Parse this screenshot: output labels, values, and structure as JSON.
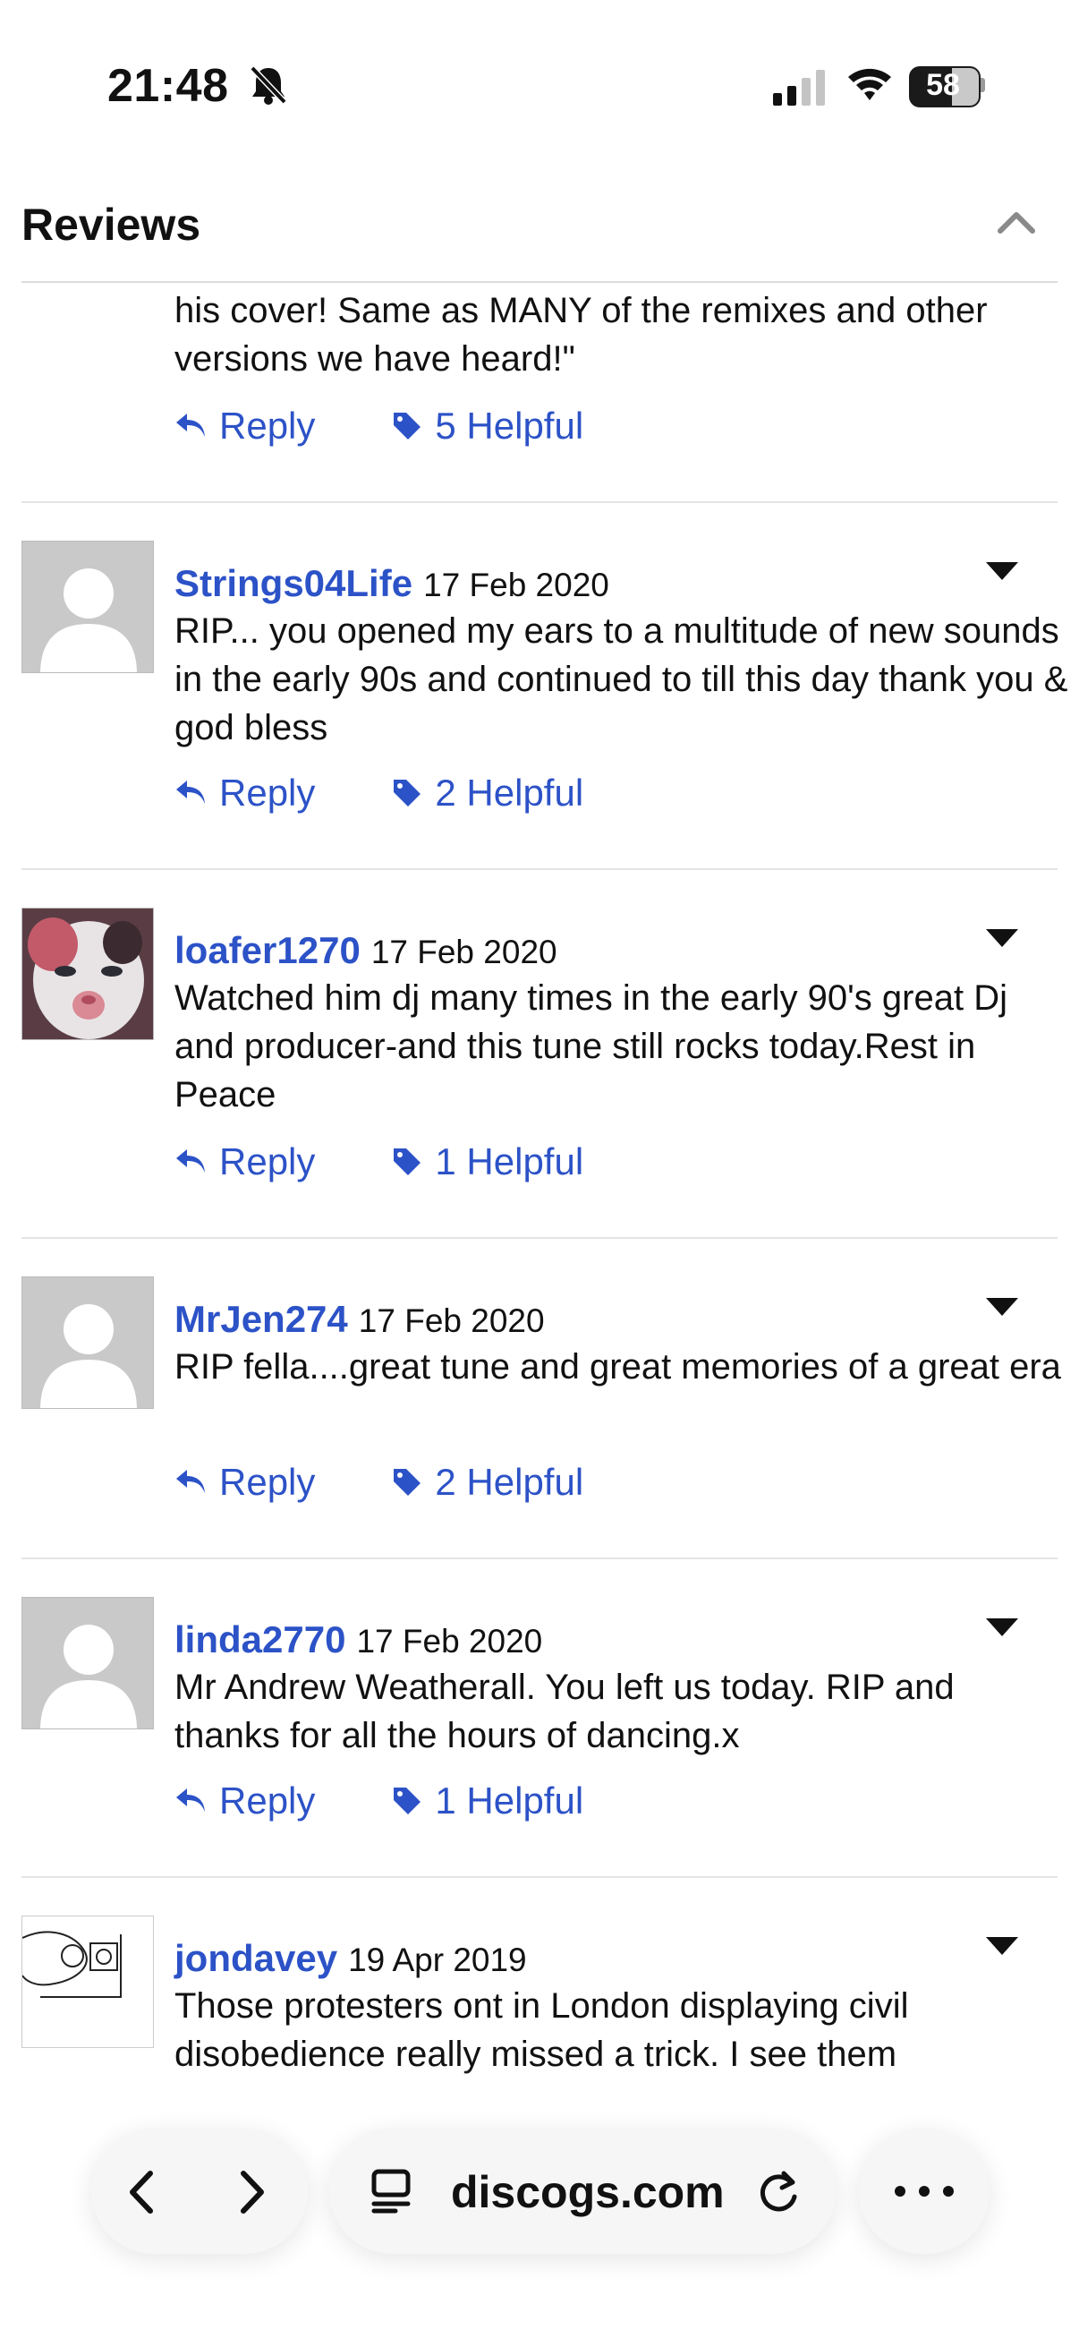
{
  "status_bar": {
    "time": "21:48",
    "battery": "58"
  },
  "header": {
    "title": "Reviews"
  },
  "top_fragment": {
    "text": "his cover! Same as MANY of the remixes and other versions we have heard!\"",
    "reply_label": "Reply",
    "helpful_label": "5 Helpful"
  },
  "reviews": [
    {
      "user": "Strings04Life",
      "date": "17 Feb 2020",
      "text": "RIP... you opened my ears to a multitude of new sounds in the early 90s and continued to till this day thank you & god bless",
      "reply_label": "Reply",
      "helpful_label": "2 Helpful"
    },
    {
      "user": "loafer1270",
      "date": "17 Feb 2020",
      "text": "Watched him dj many times in the early 90's great Dj and producer-and this tune still rocks today.Rest in Peace",
      "reply_label": "Reply",
      "helpful_label": "1 Helpful"
    },
    {
      "user": "MrJen274",
      "date": "17 Feb 2020",
      "text": "RIP fella....great tune and great memories of a great era",
      "reply_label": "Reply",
      "helpful_label": "2 Helpful"
    },
    {
      "user": "linda2770",
      "date": "17 Feb 2020",
      "text": "Mr Andrew Weatherall. You left us today. RIP and thanks for all the hours of dancing.x",
      "reply_label": "Reply",
      "helpful_label": "1 Helpful"
    },
    {
      "user": "jondavey",
      "date": "19 Apr 2019",
      "text": "Those protesters ont in London displaying civil disobedience really missed a trick. I see them"
    }
  ],
  "browser_bar": {
    "url": "discogs.com"
  },
  "colors": {
    "link": "#2c52c7",
    "divider": "#e4e4e4",
    "avatar_placeholder": "#c9c9c9"
  }
}
